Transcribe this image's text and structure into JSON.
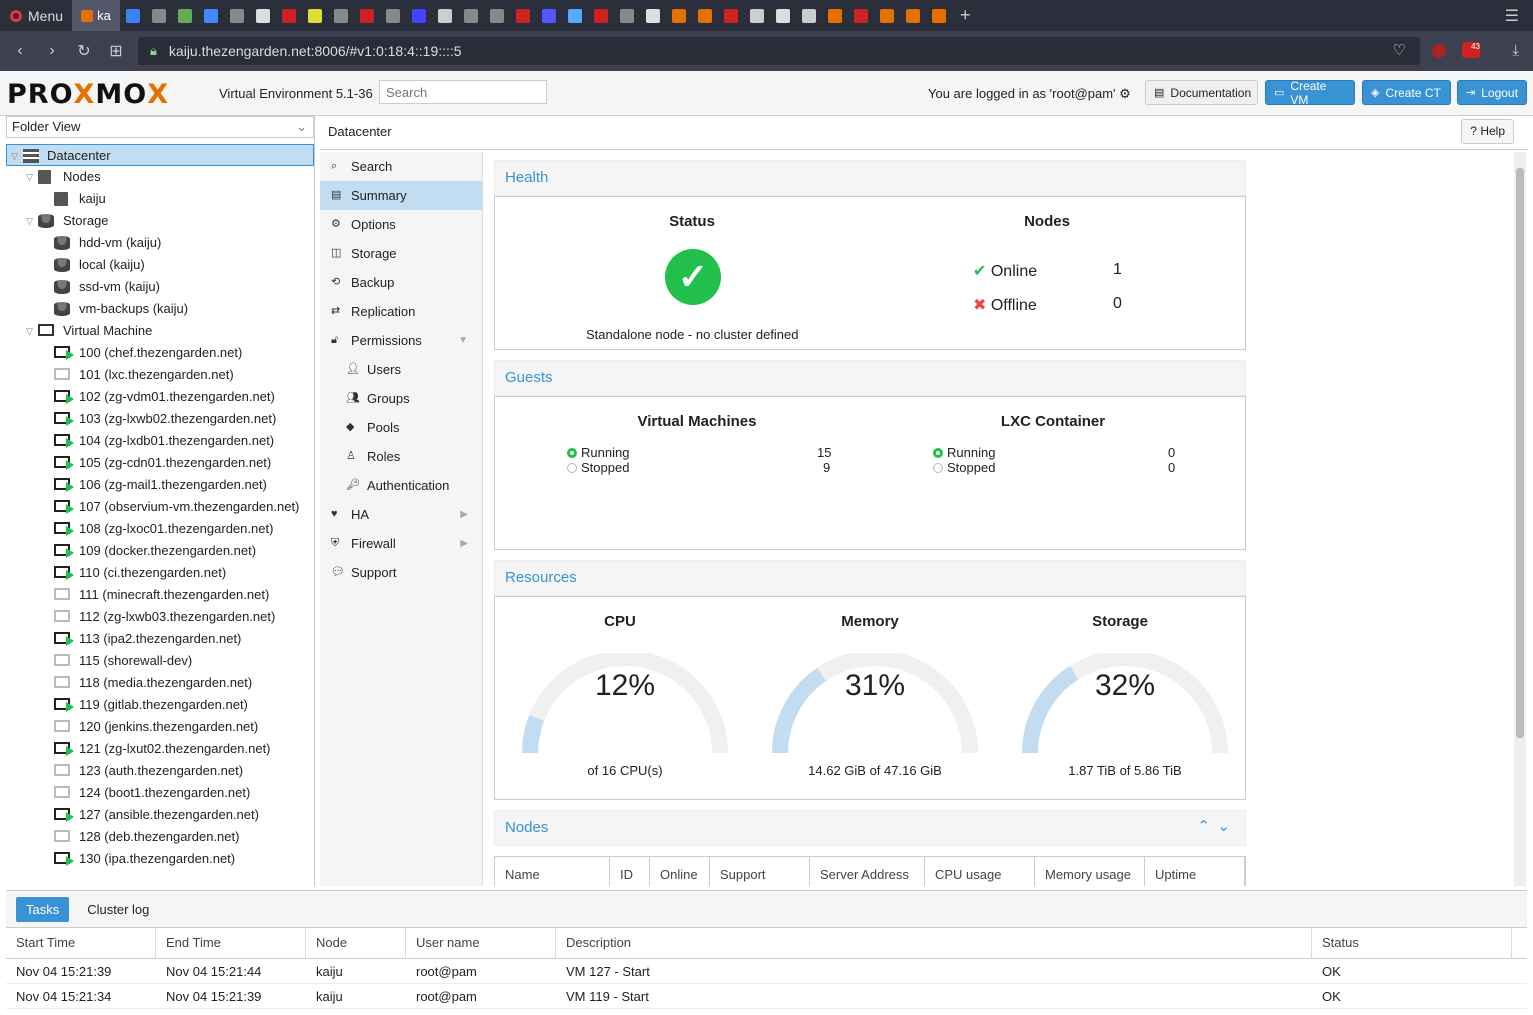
{
  "browser": {
    "menu_label": "Menu",
    "active_tab": "ka",
    "url": "kaiju.thezengarden.net:8006/#v1:0:18:4::19::::5",
    "badge_count": "43"
  },
  "header": {
    "logo_a": "PRO",
    "logo_x": "X",
    "logo_b": "MO",
    "logo_c": "X",
    "version": "Virtual Environment 5.1-36",
    "search_placeholder": "Search",
    "user_info": "You are logged in as 'root@pam'",
    "documentation": "Documentation",
    "create_vm": "Create VM",
    "create_ct": "Create CT",
    "logout": "Logout"
  },
  "tree": {
    "view": "Folder View",
    "datacenter": "Datacenter",
    "nodes": "Nodes",
    "node": "kaiju",
    "storage": "Storage",
    "storages": [
      "hdd-vm (kaiju)",
      "local (kaiju)",
      "ssd-vm (kaiju)",
      "vm-backups (kaiju)"
    ],
    "vm_folder": "Virtual Machine",
    "vms": [
      {
        "label": "100 (chef.thezengarden.net)",
        "running": true
      },
      {
        "label": "101 (lxc.thezengarden.net)",
        "running": false
      },
      {
        "label": "102 (zg-vdm01.thezengarden.net)",
        "running": true
      },
      {
        "label": "103 (zg-lxwb02.thezengarden.net)",
        "running": true
      },
      {
        "label": "104 (zg-lxdb01.thezengarden.net)",
        "running": true
      },
      {
        "label": "105 (zg-cdn01.thezengarden.net)",
        "running": true
      },
      {
        "label": "106 (zg-mail1.thezengarden.net)",
        "running": true
      },
      {
        "label": "107 (observium-vm.thezengarden.net)",
        "running": true
      },
      {
        "label": "108 (zg-lxoc01.thezengarden.net)",
        "running": true
      },
      {
        "label": "109 (docker.thezengarden.net)",
        "running": true
      },
      {
        "label": "110 (ci.thezengarden.net)",
        "running": true
      },
      {
        "label": "111 (minecraft.thezengarden.net)",
        "running": false
      },
      {
        "label": "112 (zg-lxwb03.thezengarden.net)",
        "running": false
      },
      {
        "label": "113 (ipa2.thezengarden.net)",
        "running": true
      },
      {
        "label": "115 (shorewall-dev)",
        "running": false
      },
      {
        "label": "118 (media.thezengarden.net)",
        "running": false
      },
      {
        "label": "119 (gitlab.thezengarden.net)",
        "running": true
      },
      {
        "label": "120 (jenkins.thezengarden.net)",
        "running": false
      },
      {
        "label": "121 (zg-lxut02.thezengarden.net)",
        "running": true
      },
      {
        "label": "123 (auth.thezengarden.net)",
        "running": false
      },
      {
        "label": "124 (boot1.thezengarden.net)",
        "running": false
      },
      {
        "label": "127 (ansible.thezengarden.net)",
        "running": true
      },
      {
        "label": "128 (deb.thezengarden.net)",
        "running": false
      },
      {
        "label": "130 (ipa.thezengarden.net)",
        "running": true
      }
    ]
  },
  "panel": {
    "title": "Datacenter",
    "help": "Help",
    "menu": [
      "Search",
      "Summary",
      "Options",
      "Storage",
      "Backup",
      "Replication",
      "Permissions",
      "Users",
      "Groups",
      "Pools",
      "Roles",
      "Authentication",
      "HA",
      "Firewall",
      "Support"
    ]
  },
  "health": {
    "header": "Health",
    "status_title": "Status",
    "status_note": "Standalone node - no cluster defined",
    "nodes_title": "Nodes",
    "online_label": "Online",
    "online_count": "1",
    "offline_label": "Offline",
    "offline_count": "0"
  },
  "guests": {
    "header": "Guests",
    "vm_title": "Virtual Machines",
    "lxc_title": "LXC Container",
    "running": "Running",
    "stopped": "Stopped",
    "vm_running": "15",
    "vm_stopped": "9",
    "lxc_running": "0",
    "lxc_stopped": "0"
  },
  "resources": {
    "header": "Resources",
    "cpu_title": "CPU",
    "cpu_pct": "12%",
    "cpu_value": 0.12,
    "cpu_sub": "of 16 CPU(s)",
    "mem_title": "Memory",
    "mem_pct": "31%",
    "mem_value": 0.31,
    "mem_sub": "14.62 GiB of 47.16 GiB",
    "sto_title": "Storage",
    "sto_pct": "32%",
    "sto_value": 0.32,
    "sto_sub": "1.87 TiB of 5.86 TiB"
  },
  "nodes_grid": {
    "header": "Nodes",
    "columns": [
      "Name",
      "ID",
      "Online",
      "Support",
      "Server Address",
      "CPU usage",
      "Memory usage",
      "Uptime"
    ]
  },
  "tasks": {
    "tab_tasks": "Tasks",
    "tab_cluster": "Cluster log",
    "columns": [
      "Start Time",
      "End Time",
      "Node",
      "User name",
      "Description",
      "Status"
    ],
    "rows": [
      [
        "Nov 04 15:21:39",
        "Nov 04 15:21:44",
        "kaiju",
        "root@pam",
        "VM 127 - Start",
        "OK"
      ],
      [
        "Nov 04 15:21:34",
        "Nov 04 15:21:39",
        "kaiju",
        "root@pam",
        "VM 119 - Start",
        "OK"
      ]
    ]
  }
}
